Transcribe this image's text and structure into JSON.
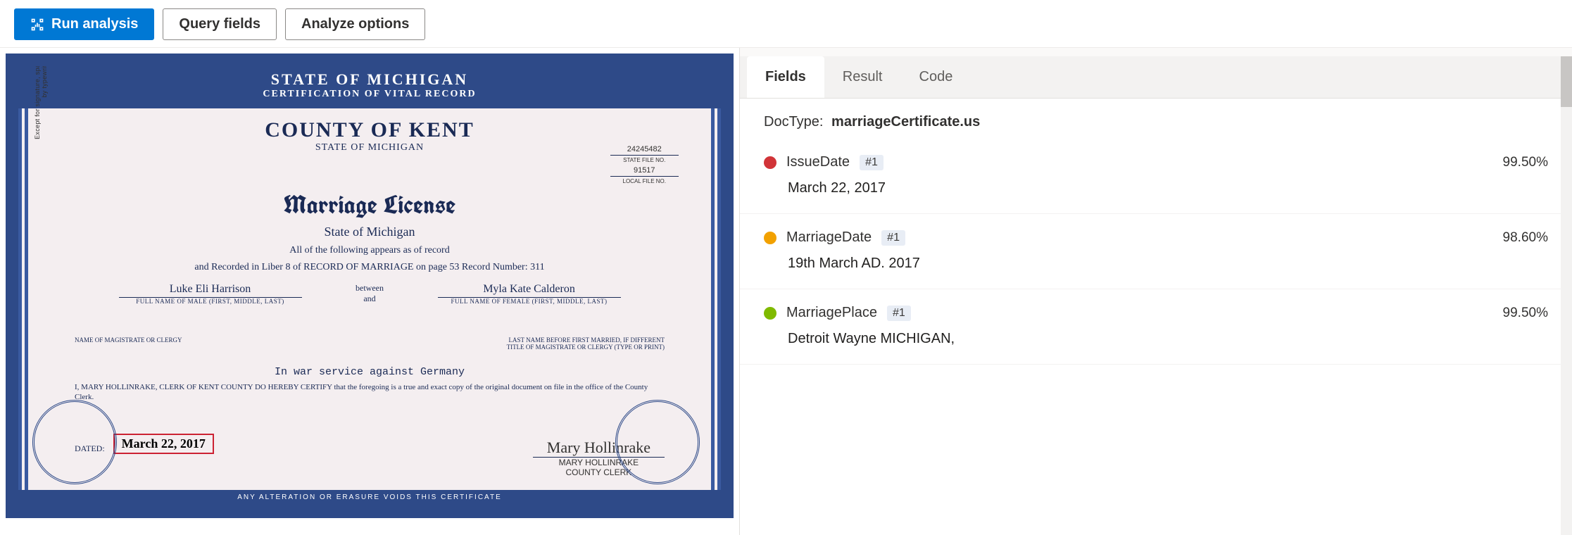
{
  "toolbar": {
    "run_label": "Run analysis",
    "query_label": "Query fields",
    "analyze_label": "Analyze options"
  },
  "document": {
    "band_title": "STATE OF MICHIGAN",
    "band_sub": "CERTIFICATION OF VITAL RECORD",
    "county": "COUNTY OF KENT",
    "state_sub": "STATE OF MICHIGAN",
    "title": "Marriage License",
    "state_line": "State of Michigan",
    "record_intro": "All of the following appears as of record",
    "record_line": "and Recorded in Liber 8 of RECORD OF MARRIAGE on page 53  Record Number: 311",
    "male_name": "Luke Eli Harrison",
    "male_cap": "FULL NAME OF MALE (FIRST, MIDDLE, LAST)",
    "between_top": "between",
    "between_bot": "and",
    "female_name": "Myla Kate Calderon",
    "female_cap": "FULL NAME OF FEMALE (FIRST, MIDDLE, LAST)",
    "lastname_cap": "LAST NAME BEFORE FIRST MARRIED, IF DIFFERENT",
    "mag_cap_l": "NAME OF MAGISTRATE OR CLERGY",
    "mag_cap_r": "TITLE OF MAGISTRATE OR CLERGY (TYPE OR PRINT)",
    "war_line": "In war service against Germany",
    "certify": "I, MARY HOLLINRAKE, CLERK OF KENT COUNTY DO HEREBY CERTIFY that the foregoing is a true and exact copy of the original document on file in the office of the County Clerk.",
    "dated_label": "DATED:",
    "dated_value": "March 22, 2017",
    "sig_name": "Mary Hollinrake",
    "sig_title": "MARY HOLLINRAKE",
    "sig_role": "COUNTY CLERK",
    "state_file_no": "24245482",
    "state_file_cap": "STATE FILE NO.",
    "local_file_no": "91517",
    "local_file_cap": "LOCAL FILE NO.",
    "side_text": "Except for signature, spaces left blank must be completed by typewriter or printed legibly",
    "footer": "ANY ALTERATION OR ERASURE VOIDS THIS CERTIFICATE"
  },
  "results": {
    "tabs": [
      "Fields",
      "Result",
      "Code"
    ],
    "active_tab": "Fields",
    "doctype_label": "DocType:",
    "doctype_value": "marriageCertificate.us",
    "fields": [
      {
        "color": "#d13438",
        "name": "IssueDate",
        "badge": "#1",
        "confidence": "99.50%",
        "value": "March 22, 2017"
      },
      {
        "color": "#f2a100",
        "name": "MarriageDate",
        "badge": "#1",
        "confidence": "98.60%",
        "value": "19th March AD. 2017"
      },
      {
        "color": "#7fba00",
        "name": "MarriagePlace",
        "badge": "#1",
        "confidence": "99.50%",
        "value": "Detroit Wayne MICHIGAN,"
      }
    ]
  }
}
